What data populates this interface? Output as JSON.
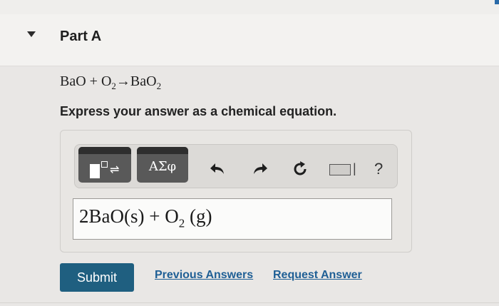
{
  "part": {
    "title": "Part A"
  },
  "question": {
    "reactant1": "BaO",
    "plus": "+",
    "reactant2_base": "O",
    "reactant2_sub": "2",
    "arrow": "→",
    "product_base": "BaO",
    "product_sub": "2"
  },
  "instruction": "Express your answer as a chemical equation.",
  "toolbar": {
    "greek_label": "ΑΣφ",
    "help_label": "?"
  },
  "answer": {
    "part1": "2BaO(s)",
    "plus": "+",
    "o_base": "O",
    "o_sub": "2",
    "state": "(g)"
  },
  "actions": {
    "submit_label": "Submit",
    "previous_answers_label": "Previous Answers",
    "request_answer_label": "Request Answer"
  },
  "colors": {
    "submit": "#1f5f80",
    "link": "#1f5f95",
    "toolbar_button": "#595959"
  }
}
